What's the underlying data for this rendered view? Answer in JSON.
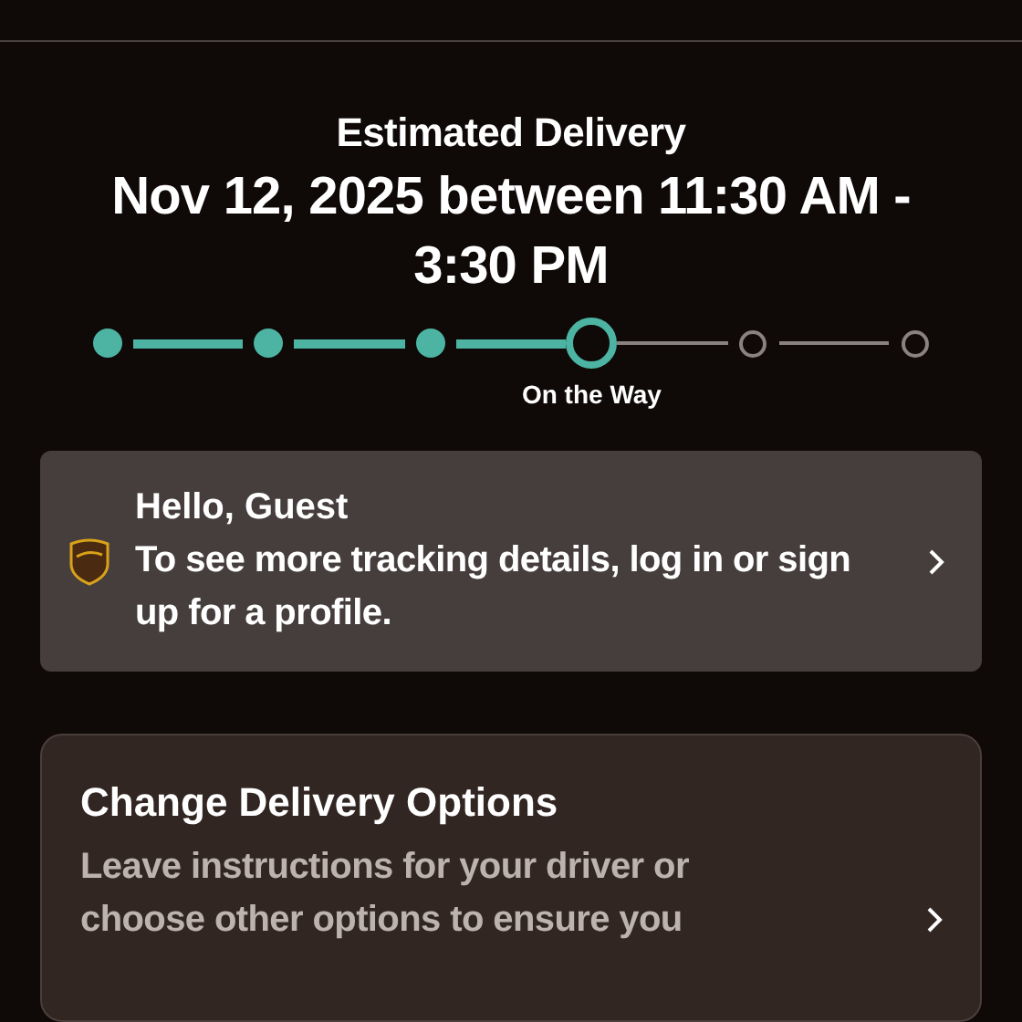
{
  "delivery": {
    "heading": "Estimated Delivery",
    "date": "Nov 12, 2025 between 11:30 AM - 3:30 PM"
  },
  "progress": {
    "steps": [
      {
        "completed": true,
        "selected": false
      },
      {
        "completed": true,
        "selected": false
      },
      {
        "completed": true,
        "selected": false
      },
      {
        "completed": false,
        "selected": true,
        "label": "On the Way"
      },
      {
        "completed": false,
        "selected": false
      },
      {
        "completed": false,
        "selected": false
      }
    ]
  },
  "guest_card": {
    "title": "Hello, Guest",
    "message": "To see more tracking details, log in or sign up for a profile."
  },
  "options_card": {
    "title": "Change Delivery Options",
    "description": "Leave instructions for your driver or choose other options to ensure you"
  }
}
